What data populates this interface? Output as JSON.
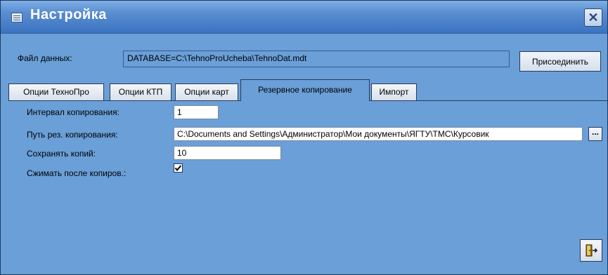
{
  "window": {
    "title": "Настройка",
    "close_label": "✕"
  },
  "database": {
    "label": "Файл данных:",
    "value": "DATABASE=C:\\TehnoProUcheba\\TehnoDat.mdt",
    "attach_label": "Присоединить"
  },
  "tabs": [
    {
      "label": "Опции ТехноПро"
    },
    {
      "label": "Опции КТП"
    },
    {
      "label": "Опции карт"
    },
    {
      "label": "Резервное копирование",
      "active": true
    },
    {
      "label": "Импорт"
    }
  ],
  "backup": {
    "interval_label": "Интервал копирования:",
    "interval_value": "1",
    "path_label": "Путь рез. копирования:",
    "path_value": "C:\\Documents and Settings\\Администратор\\Мои документы\\ЯГТУ\\ТМС\\Курсовик",
    "browse_label": "...",
    "copies_label": "Сохранять копий:",
    "copies_value": "10",
    "compress_label": "Сжимать после копиров.:",
    "compress_checked": true
  },
  "icons": {
    "app": "form-window-icon",
    "close": "close-icon",
    "exit": "exit-door-icon"
  },
  "colors": {
    "titlebar": "#3c73c2",
    "background": "#6a9fd8"
  }
}
